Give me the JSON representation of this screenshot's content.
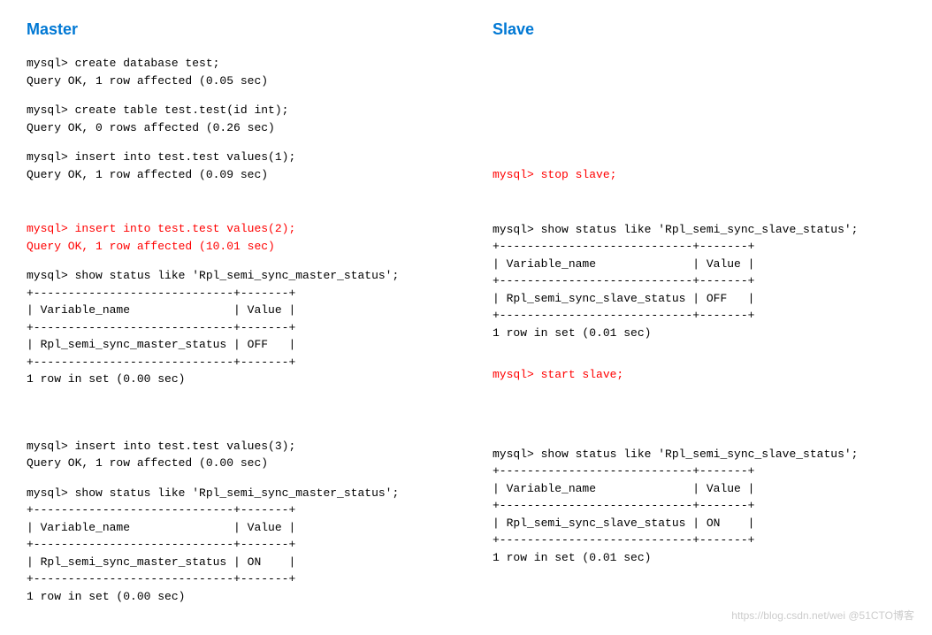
{
  "master": {
    "heading": "Master",
    "blk1": "mysql> create database test;\nQuery OK, 1 row affected (0.05 sec)",
    "blk2": "mysql> create table test.test(id int);\nQuery OK, 0 rows affected (0.26 sec)",
    "blk3": "mysql> insert into test.test values(1);\nQuery OK, 1 row affected (0.09 sec)",
    "blk4": "mysql> insert into test.test values(2);\nQuery OK, 1 row affected (10.01 sec)",
    "blk5": "mysql> show status like 'Rpl_semi_sync_master_status';\n+-----------------------------+-------+\n| Variable_name               | Value |\n+-----------------------------+-------+\n| Rpl_semi_sync_master_status | OFF   |\n+-----------------------------+-------+\n1 row in set (0.00 sec)",
    "blk6": "mysql> insert into test.test values(3);\nQuery OK, 1 row affected (0.00 sec)",
    "blk7": "mysql> show status like 'Rpl_semi_sync_master_status';\n+-----------------------------+-------+\n| Variable_name               | Value |\n+-----------------------------+-------+\n| Rpl_semi_sync_master_status | ON    |\n+-----------------------------+-------+\n1 row in set (0.00 sec)"
  },
  "slave": {
    "heading": "Slave",
    "blk1": "mysql> stop slave;",
    "blk2": "mysql> show status like 'Rpl_semi_sync_slave_status';\n+----------------------------+-------+\n| Variable_name              | Value |\n+----------------------------+-------+\n| Rpl_semi_sync_slave_status | OFF   |\n+----------------------------+-------+\n1 row in set (0.01 sec)",
    "blk3": "mysql> start slave;",
    "blk4": "mysql> show status like 'Rpl_semi_sync_slave_status';\n+----------------------------+-------+\n| Variable_name              | Value |\n+----------------------------+-------+\n| Rpl_semi_sync_slave_status | ON    |\n+----------------------------+-------+\n1 row in set (0.01 sec)"
  },
  "watermark": "https://blog.csdn.net/wei @51CTO博客"
}
